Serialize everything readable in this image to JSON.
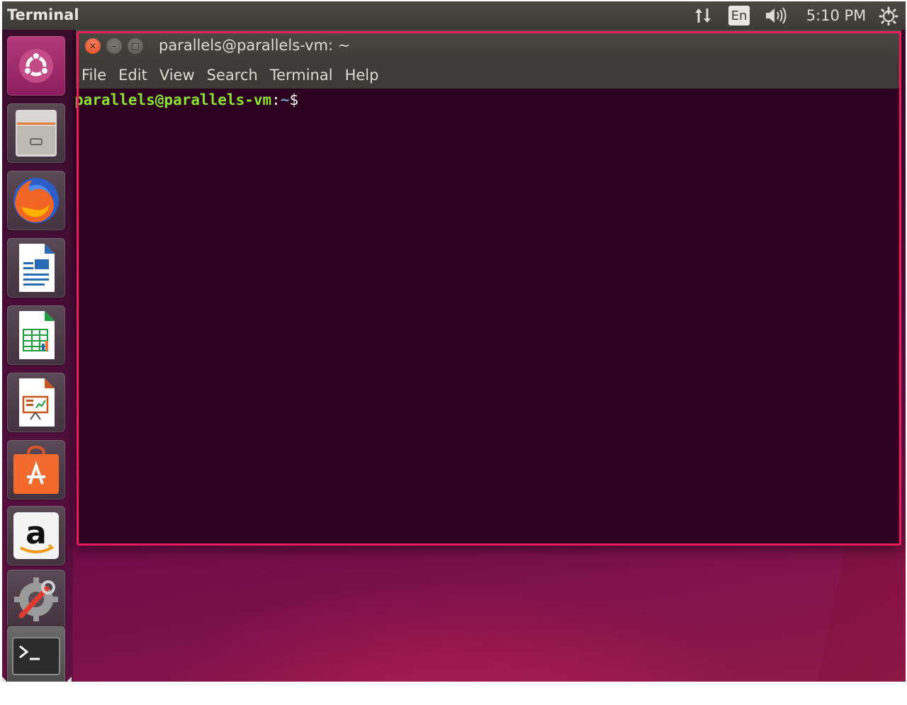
{
  "top_panel": {
    "app_title": "Terminal",
    "indicators": {
      "network_icon": "network-updown-icon",
      "keyboard_layout": "En",
      "volume_icon": "volume-icon",
      "clock": "5:10 PM",
      "session_icon": "power-gear-icon"
    }
  },
  "launcher": {
    "items": [
      {
        "name": "Dash",
        "icon": "ubuntu-logo-icon"
      },
      {
        "name": "Files",
        "icon": "file-cabinet-icon"
      },
      {
        "name": "Firefox",
        "icon": "firefox-icon"
      },
      {
        "name": "LibreOffice Writer",
        "icon": "writer-document-icon"
      },
      {
        "name": "LibreOffice Calc",
        "icon": "calc-spreadsheet-icon"
      },
      {
        "name": "LibreOffice Impress",
        "icon": "impress-presentation-icon"
      },
      {
        "name": "Ubuntu Software",
        "icon": "shopping-bag-icon"
      },
      {
        "name": "Amazon",
        "icon": "amazon-icon"
      },
      {
        "name": "System Settings",
        "icon": "settings-wrench-icon"
      },
      {
        "name": "Terminal",
        "icon": "terminal-prompt-icon",
        "active": true
      }
    ]
  },
  "window": {
    "title": "parallels@parallels-vm: ~",
    "buttons": {
      "close": "×",
      "minimize": "–",
      "maximize": "□"
    },
    "menu": [
      "File",
      "Edit",
      "View",
      "Search",
      "Terminal",
      "Help"
    ],
    "terminal": {
      "user_host": "parallels@parallels-vm",
      "separator": ":",
      "path": "~",
      "symbol": "$"
    }
  },
  "colors": {
    "terminal_bg": "#2c001e",
    "prompt_user": "#8ae234",
    "prompt_path": "#729fcf",
    "highlight_border": "#ee1c5b",
    "panel_bg": "#3c3b37"
  }
}
